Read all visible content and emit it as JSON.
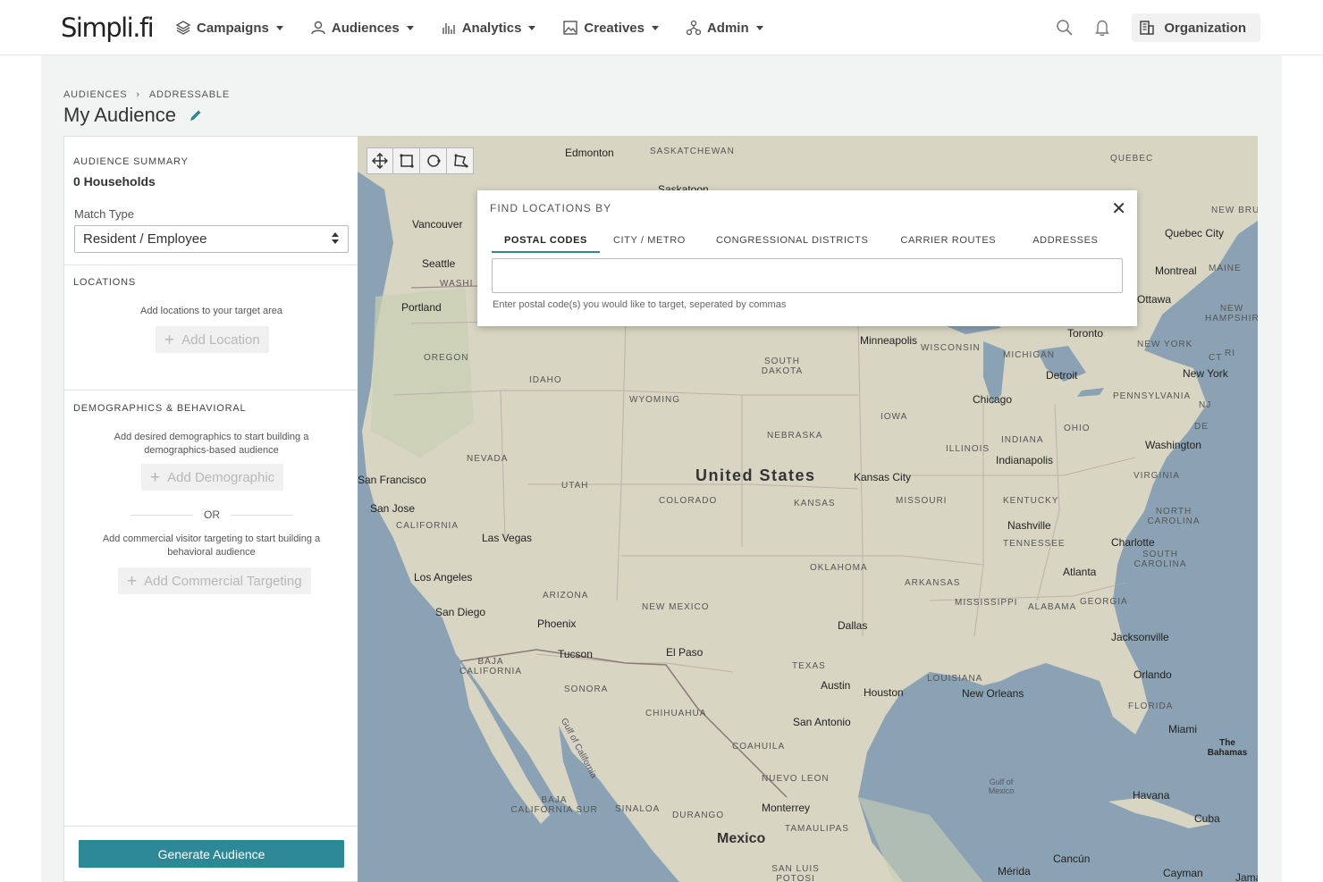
{
  "app": {
    "logo": "Simpli.fi"
  },
  "nav": {
    "items": [
      {
        "label": "Campaigns",
        "icon": "layers-icon"
      },
      {
        "label": "Audiences",
        "icon": "users-icon"
      },
      {
        "label": "Analytics",
        "icon": "bar-chart-icon"
      },
      {
        "label": "Creatives",
        "icon": "image-icon"
      },
      {
        "label": "Admin",
        "icon": "org-tree-icon"
      }
    ],
    "organization": "Organization"
  },
  "breadcrumb": {
    "root": "AUDIENCES",
    "current": "ADDRESSABLE"
  },
  "page": {
    "title": "My Audience"
  },
  "summary": {
    "heading": "AUDIENCE SUMMARY",
    "households": "0 Households",
    "match_type_label": "Match Type",
    "match_type_value": "Resident / Employee"
  },
  "locations": {
    "heading": "LOCATIONS",
    "hint": "Add locations to your target area",
    "button": "Add Location"
  },
  "demographics": {
    "heading": "DEMOGRAPHICS & BEHAVIORAL",
    "hint1": "Add desired demographics to start building a",
    "hint1b": "demographics-based audience",
    "button1": "Add Demographic",
    "or": "OR",
    "hint2": "Add commercial visitor targeting to start building a",
    "hint2b": "behavioral audience",
    "button2": "Add Commercial Targeting"
  },
  "generate_button": "Generate Audience",
  "modal": {
    "title": "FIND LOCATIONS BY",
    "tabs": [
      "POSTAL CODES",
      "CITY / METRO",
      "CONGRESSIONAL DISTRICTS",
      "CARRIER ROUTES",
      "ADDRESSES"
    ],
    "active_tab": "POSTAL CODES",
    "input_value": "",
    "helper": "Enter postal code(s) you would like to target, seperated by commas"
  },
  "map": {
    "country": "United States",
    "mexico": "Mexico",
    "states": [
      "SASKATCHEWAN",
      "QUEBEC",
      "OREGON",
      "IDAHO",
      "WYOMING",
      "SOUTH DAKOTA",
      "NEBRASKA",
      "IOWA",
      "NEVADA",
      "UTAH",
      "COLORADO",
      "KANSAS",
      "MISSOURI",
      "ILLINOIS",
      "INDIANA",
      "OHIO",
      "CALIFORNIA",
      "ARIZONA",
      "NEW MEXICO",
      "OKLAHOMA",
      "ARKANSAS",
      "TEXAS",
      "MISSISSIPPI",
      "ALABAMA",
      "GEORGIA",
      "TENNESSEE",
      "KENTUCKY",
      "VIRGINIA",
      "NORTH CAROLINA",
      "SOUTH CAROLINA",
      "FLORIDA",
      "LOUISIANA",
      "MICHIGAN",
      "WISCONSIN",
      "PENNSYLVANIA",
      "NEW YORK",
      "NEW HAMPSHIRE",
      "MAINE",
      "SONORA",
      "CHIHUAHUA",
      "COAHUILA",
      "NUEVO LEON",
      "TAMAULIPAS",
      "BAJA CALIFORNIA",
      "BAJA CALIFORNIA SUR",
      "SINALOA",
      "DURANGO",
      "WASHI",
      "NEW BRUNS",
      "CT",
      "RI",
      "NJ",
      "DE",
      "SAN LUIS POTOSI"
    ],
    "cities": [
      "Edmonton",
      "Vancouver",
      "Seattle",
      "Portland",
      "Quebec City",
      "Montreal",
      "Ottawa",
      "Toronto",
      "Minneapolis",
      "Detroit",
      "New York",
      "Chicago",
      "Washington",
      "Indianapolis",
      "Kansas City",
      "San Francisco",
      "San Jose",
      "Las Vegas",
      "Los Angeles",
      "San Diego",
      "Phoenix",
      "Tucson",
      "El Paso",
      "Dallas",
      "Austin",
      "Houston",
      "San Antonio",
      "New Orleans",
      "Nashville",
      "Charlotte",
      "Atlanta",
      "Jacksonville",
      "Orlando",
      "Miami",
      "The Bahamas",
      "Havana",
      "Cuba",
      "Monterrey",
      "Cancún",
      "Mérida",
      "Cayman",
      "Gulf of California",
      "Gulf of Mexico",
      "Saskatoon",
      "Jama"
    ]
  }
}
